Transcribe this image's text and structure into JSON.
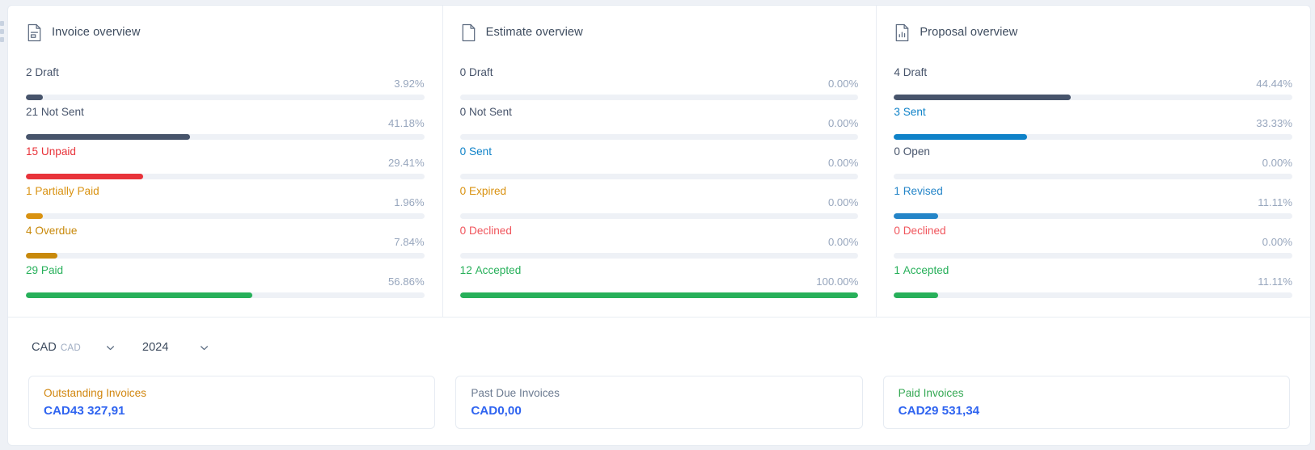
{
  "colors": {
    "draft": "#47546b",
    "not_sent": "#47546b",
    "unpaid": "#e8333a",
    "partially_paid": "#d99211",
    "overdue": "#c8890b",
    "paid": "#27b05a",
    "sent": "#0f82c8",
    "revised": "#2485c8",
    "expired": "#d99211",
    "declined": "#f0555c",
    "accepted": "#27b05a",
    "open": "#47546b",
    "track": "#eef1f6",
    "percent_text": "#97a6bd",
    "value_blue": "#2f64f0",
    "muted_title": "#6b7a90"
  },
  "panels": [
    {
      "title": "Invoice overview",
      "icon": "document-lines-icon",
      "stats": [
        {
          "count": "2",
          "label": "Draft",
          "percent": "3.92%",
          "value": 3.92,
          "color_key": "draft"
        },
        {
          "count": "21",
          "label": "Not Sent",
          "percent": "41.18%",
          "value": 41.18,
          "color_key": "not_sent"
        },
        {
          "count": "15",
          "label": "Unpaid",
          "percent": "29.41%",
          "value": 29.41,
          "color_key": "unpaid"
        },
        {
          "count": "1",
          "label": "Partially Paid",
          "percent": "1.96%",
          "value": 1.96,
          "color_key": "partially_paid"
        },
        {
          "count": "4",
          "label": "Overdue",
          "percent": "7.84%",
          "value": 7.84,
          "color_key": "overdue"
        },
        {
          "count": "29",
          "label": "Paid",
          "percent": "56.86%",
          "value": 56.86,
          "color_key": "paid"
        }
      ]
    },
    {
      "title": "Estimate overview",
      "icon": "document-blank-icon",
      "stats": [
        {
          "count": "0",
          "label": "Draft",
          "percent": "0.00%",
          "value": 0,
          "color_key": "draft"
        },
        {
          "count": "0",
          "label": "Not Sent",
          "percent": "0.00%",
          "value": 0,
          "color_key": "not_sent"
        },
        {
          "count": "0",
          "label": "Sent",
          "percent": "0.00%",
          "value": 0,
          "color_key": "sent"
        },
        {
          "count": "0",
          "label": "Expired",
          "percent": "0.00%",
          "value": 0,
          "color_key": "expired"
        },
        {
          "count": "0",
          "label": "Declined",
          "percent": "0.00%",
          "value": 0,
          "color_key": "declined"
        },
        {
          "count": "12",
          "label": "Accepted",
          "percent": "100.00%",
          "value": 100,
          "color_key": "accepted"
        }
      ]
    },
    {
      "title": "Proposal overview",
      "icon": "document-chart-icon",
      "stats": [
        {
          "count": "4",
          "label": "Draft",
          "percent": "44.44%",
          "value": 44.44,
          "color_key": "draft"
        },
        {
          "count": "3",
          "label": "Sent",
          "percent": "33.33%",
          "value": 33.33,
          "color_key": "sent"
        },
        {
          "count": "0",
          "label": "Open",
          "percent": "0.00%",
          "value": 0,
          "color_key": "open"
        },
        {
          "count": "1",
          "label": "Revised",
          "percent": "11.11%",
          "value": 11.11,
          "color_key": "revised"
        },
        {
          "count": "0",
          "label": "Declined",
          "percent": "0.00%",
          "value": 0,
          "color_key": "declined"
        },
        {
          "count": "1",
          "label": "Accepted",
          "percent": "11.11%",
          "value": 11.11,
          "color_key": "accepted"
        }
      ]
    }
  ],
  "filters": {
    "currency": {
      "value": "CAD",
      "code": "CAD",
      "chevron": "chevron-down-icon"
    },
    "year": {
      "value": "2024",
      "chevron": "chevron-down-icon"
    }
  },
  "tiles": [
    {
      "title": "Outstanding Invoices",
      "value": "CAD43 327,91",
      "title_color": "#d1860f"
    },
    {
      "title": "Past Due Invoices",
      "value": "CAD0,00",
      "title_color": "#6b7a90"
    },
    {
      "title": "Paid Invoices",
      "value": "CAD29 531,34",
      "title_color": "#34a853"
    }
  ]
}
